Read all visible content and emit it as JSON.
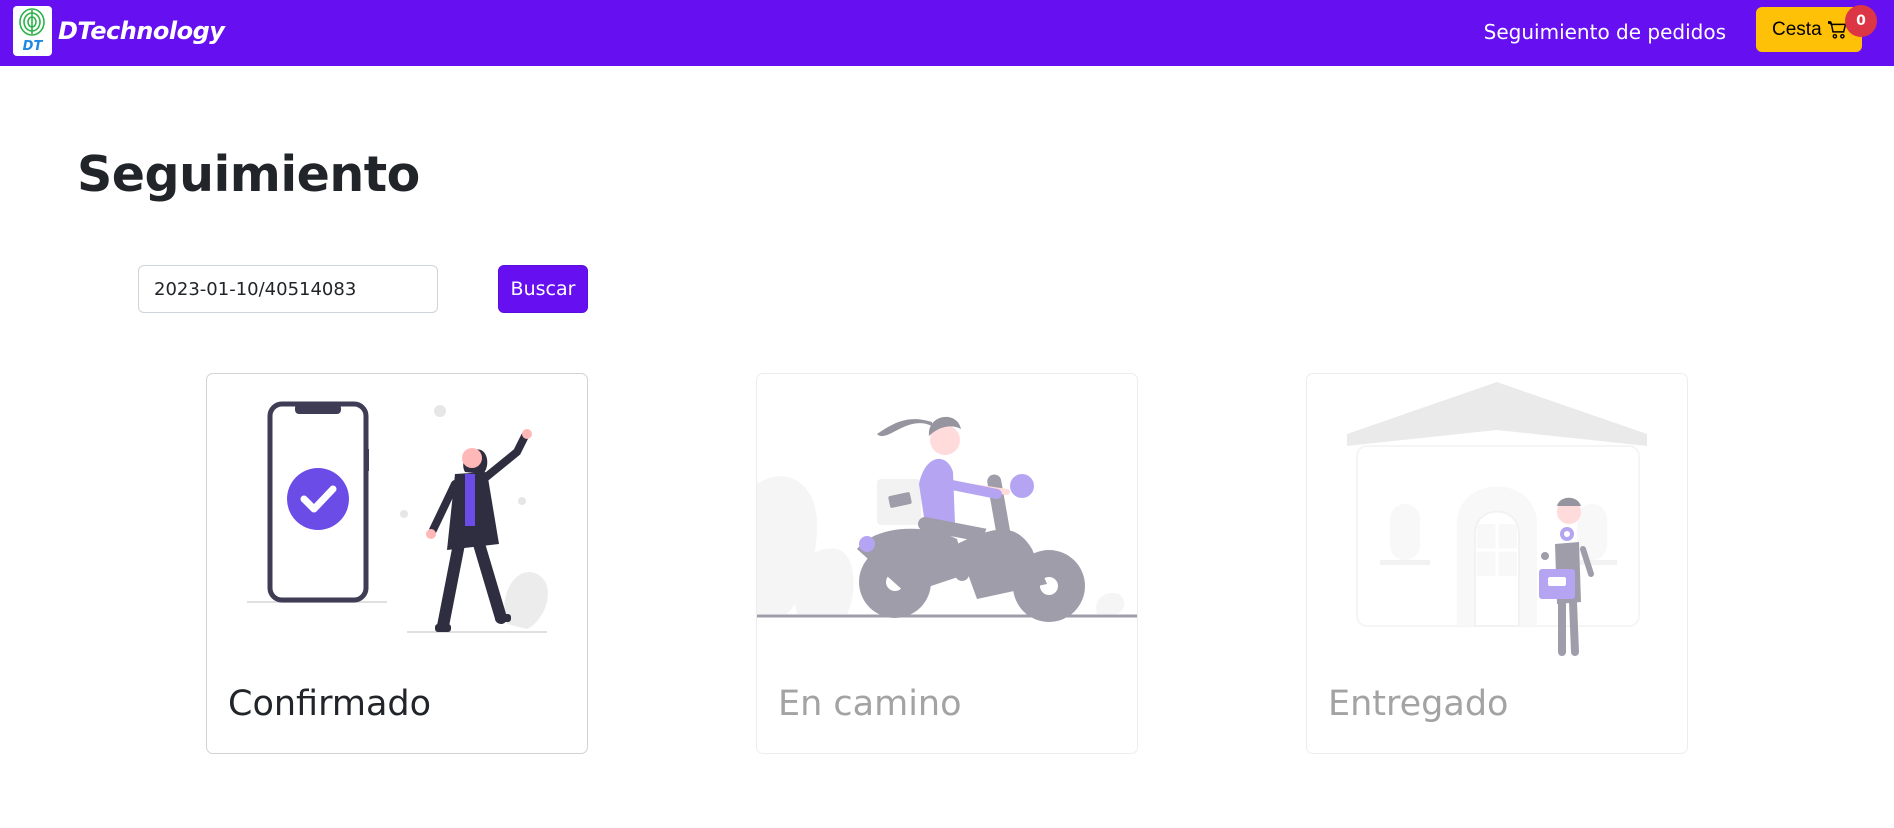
{
  "navbar": {
    "brand_initials": "DT",
    "brand_name": "DTechnology",
    "tracking_link": "Seguimiento de pedidos",
    "cart_label": "Cesta",
    "cart_count": "0",
    "background_color": "#6610f2",
    "cart_color": "#ffc107",
    "badge_color": "#dc3545"
  },
  "page": {
    "title": "Seguimiento"
  },
  "search": {
    "value": "2023-01-10/40514083",
    "button_label": "Buscar"
  },
  "steps": [
    {
      "label": "Confirmado",
      "active": true,
      "icon": "phone-check-illustration"
    },
    {
      "label": "En camino",
      "active": false,
      "icon": "scooter-delivery-illustration"
    },
    {
      "label": "Entregado",
      "active": false,
      "icon": "house-delivery-illustration"
    }
  ]
}
